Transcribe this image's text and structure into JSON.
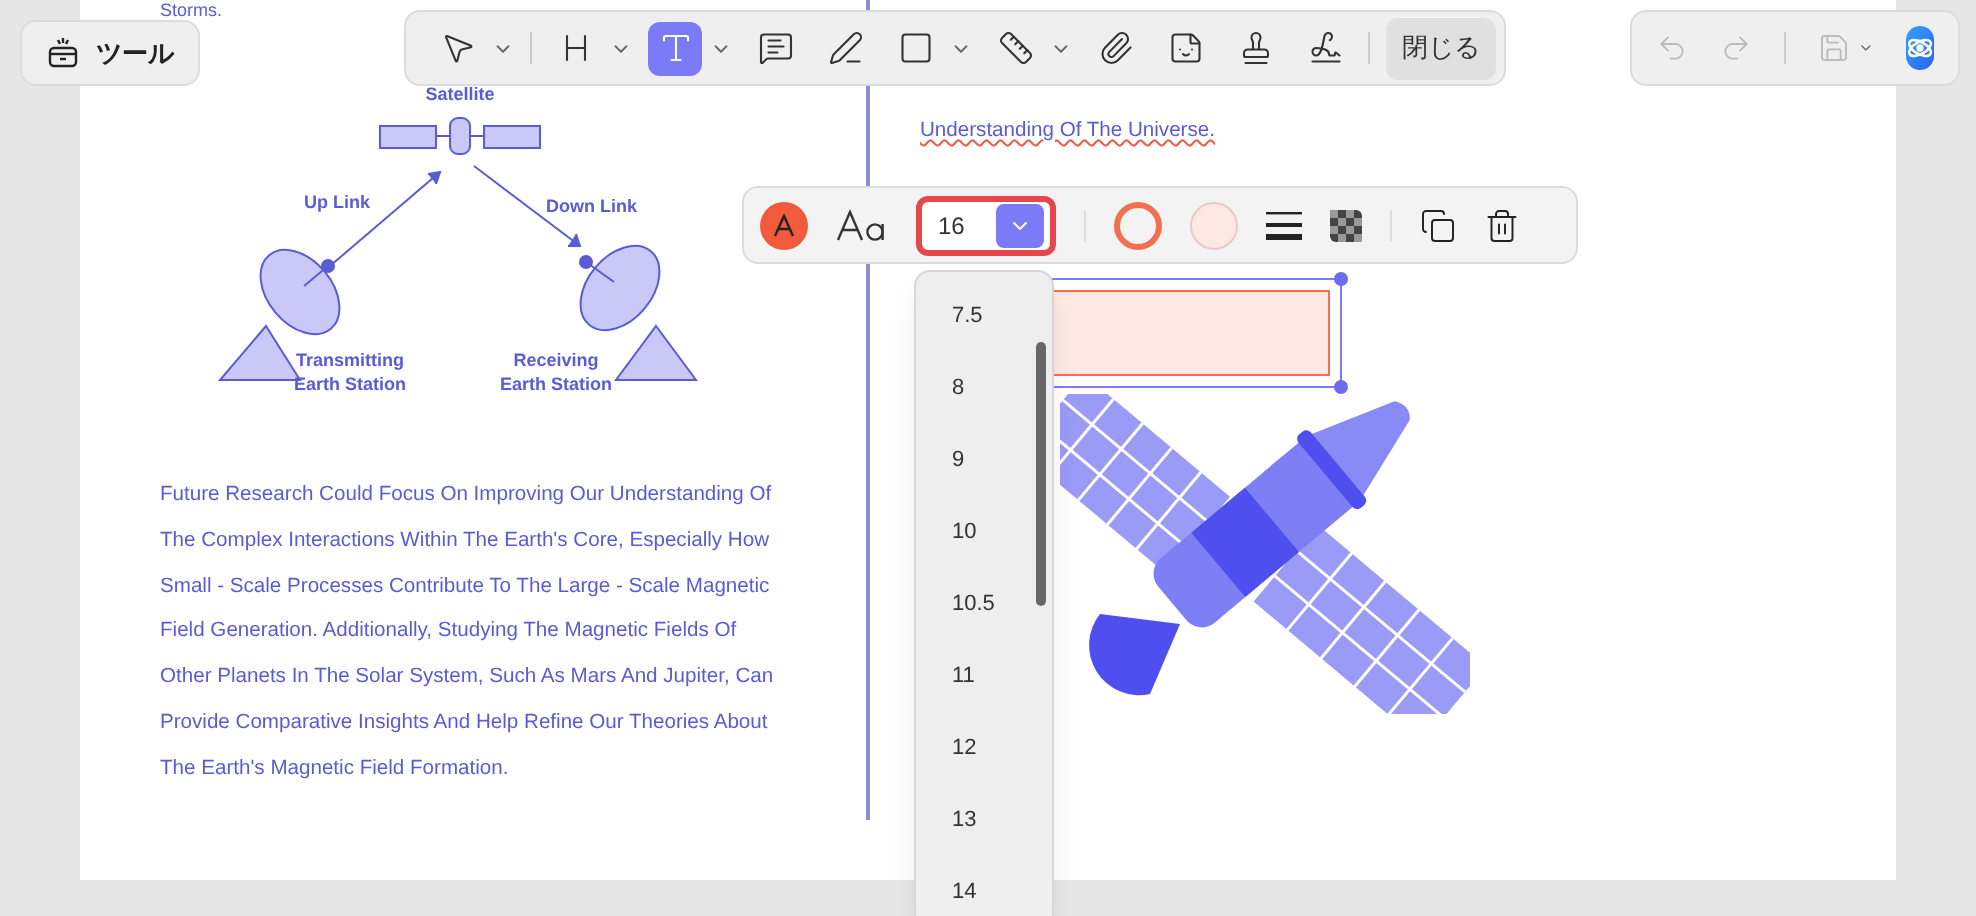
{
  "side_button": {
    "label": "ツール"
  },
  "main_toolbar": {
    "tools": [
      {
        "kind": "select",
        "selected": false,
        "has_menu": true
      },
      {
        "kind": "heading",
        "selected": false,
        "has_menu": true
      },
      {
        "kind": "textbox",
        "selected": true,
        "has_menu": true
      },
      {
        "kind": "comment",
        "selected": false,
        "has_menu": false
      },
      {
        "kind": "pen",
        "selected": false,
        "has_menu": false
      },
      {
        "kind": "shape",
        "selected": false,
        "has_menu": true
      },
      {
        "kind": "measure",
        "selected": false,
        "has_menu": true
      },
      {
        "kind": "attach",
        "selected": false,
        "has_menu": false
      },
      {
        "kind": "sticker",
        "selected": false,
        "has_menu": false
      },
      {
        "kind": "stamp",
        "selected": false,
        "has_menu": false
      },
      {
        "kind": "signature",
        "selected": false,
        "has_menu": false
      }
    ],
    "close_label": "閉じる"
  },
  "history_toolbar": {
    "items": [
      {
        "kind": "undo",
        "disabled": true
      },
      {
        "kind": "redo",
        "disabled": true
      },
      {
        "kind": "save",
        "disabled": true
      }
    ]
  },
  "document": {
    "left_column": {
      "top_fragment": "Storms.",
      "diagram": {
        "satellite": "Satellite",
        "uplink": "Up Link",
        "downlink": "Down Link",
        "transmitter": [
          "Transmitting",
          "Earth Station"
        ],
        "receiver": [
          "Receiving",
          "Earth Station"
        ]
      },
      "paragraph_lines": [
        "Future Research Could Focus On Improving Our Understanding Of",
        "The Complex Interactions Within The Earth's Core, Especially How",
        "Small - Scale Processes Contribute To The Large - Scale Magnetic",
        "Field Generation. Additionally, Studying The Magnetic Fields Of",
        "Other Planets In The Solar System, Such As Mars And Jupiter, Can",
        "Provide Comparative Insights And Help Refine Our Theories About",
        "The Earth's Magnetic Field Formation."
      ]
    },
    "right_column": {
      "fragment": "Understanding Of The Universe."
    }
  },
  "format_toolbar": {
    "font_size": "16",
    "font_size_open": true
  },
  "font_size_menu": {
    "options": [
      {
        "label": "7.5",
        "selected": false
      },
      {
        "label": "8",
        "selected": false
      },
      {
        "label": "9",
        "selected": false
      },
      {
        "label": "10",
        "selected": false
      },
      {
        "label": "10.5",
        "selected": false
      },
      {
        "label": "11",
        "selected": false
      },
      {
        "label": "12",
        "selected": false
      },
      {
        "label": "13",
        "selected": false
      },
      {
        "label": "14",
        "selected": false
      }
    ]
  }
}
